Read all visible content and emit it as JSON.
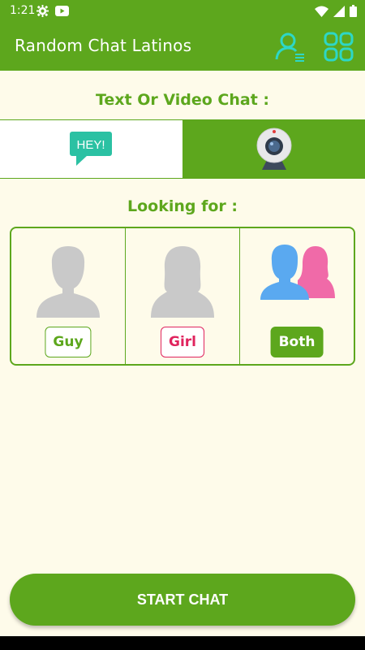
{
  "status_bar": {
    "time": "1:21"
  },
  "app_bar": {
    "title": "Random Chat Latinos"
  },
  "chat_type": {
    "heading": "Text Or Video Chat :",
    "text_bubble_label": "HEY!"
  },
  "looking_for": {
    "heading": "Looking for :",
    "options": [
      {
        "label": "Guy"
      },
      {
        "label": "Girl"
      },
      {
        "label": "Both"
      }
    ]
  },
  "start_button": {
    "label": "START CHAT"
  },
  "colors": {
    "primary": "#5da71d",
    "background": "#fefbea",
    "girl": "#e0245e",
    "both_blue": "#5aa9f0",
    "both_pink": "#f06aa8",
    "bubble_teal": "#2bc1a3"
  }
}
